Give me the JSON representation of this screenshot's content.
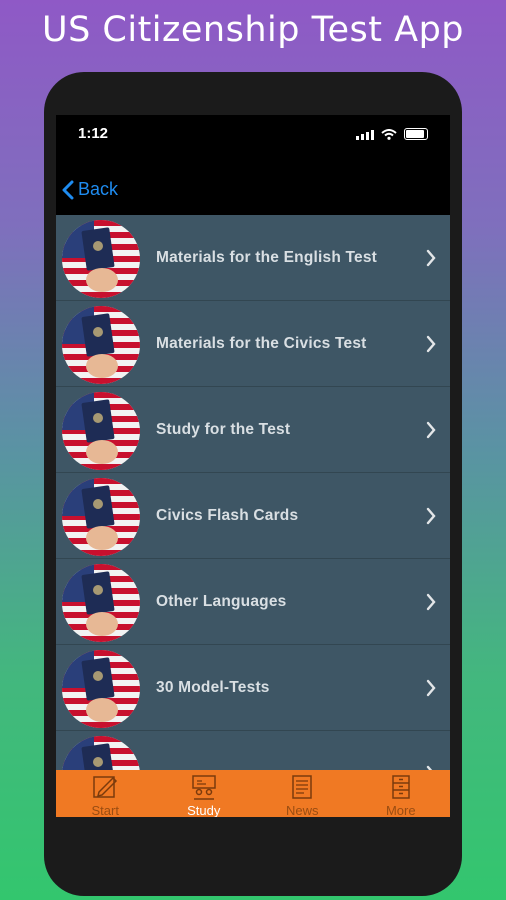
{
  "promo": {
    "title": "US Citizenship Test App"
  },
  "status_bar": {
    "time": "1:12"
  },
  "nav": {
    "back_label": "Back"
  },
  "list": {
    "items": [
      {
        "label": "Materials for the English Test",
        "icon": "passport-flag-icon"
      },
      {
        "label": "Materials for the Civics Test",
        "icon": "passport-flag-icon"
      },
      {
        "label": "Study for the Test",
        "icon": "passport-flag-icon"
      },
      {
        "label": "Civics Flash Cards",
        "icon": "passport-flag-icon"
      },
      {
        "label": "Other Languages",
        "icon": "passport-flag-icon"
      },
      {
        "label": "30 Model-Tests",
        "icon": "passport-flag-icon"
      },
      {
        "label": "",
        "icon": "passport-flag-icon"
      }
    ]
  },
  "tab_bar": {
    "active": "Study",
    "tabs": [
      {
        "label": "Start",
        "icon": "notebook-pencil-icon"
      },
      {
        "label": "Study",
        "icon": "classroom-icon"
      },
      {
        "label": "News",
        "icon": "newspaper-icon"
      },
      {
        "label": "More",
        "icon": "cabinet-icon"
      }
    ]
  },
  "colors": {
    "accent_blue": "#1f8cf0",
    "row_bg": "#3e5665",
    "tab_bar": "#f07923"
  }
}
